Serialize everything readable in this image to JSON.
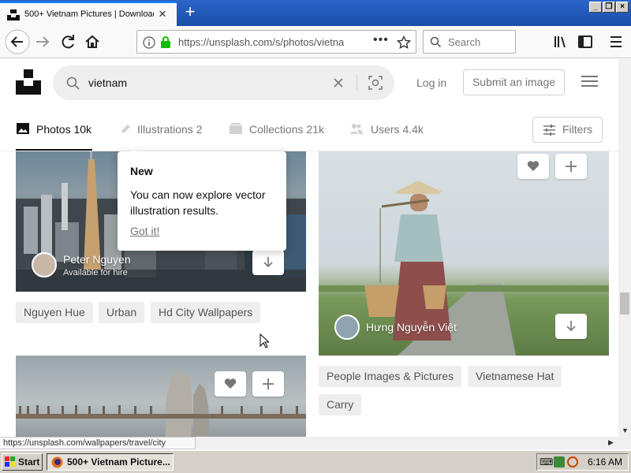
{
  "browser": {
    "tab_title": "500+ Vietnam Pictures | Download",
    "url": "https://unsplash.com/s/photos/vietna",
    "search_placeholder": "Search",
    "status_url": "https://unsplash.com/wallpapers/travel/city"
  },
  "header": {
    "search_query": "vietnam",
    "login_label": "Log in",
    "submit_label": "Submit an image",
    "filters_label": "Filters",
    "tabs": [
      {
        "label": "Photos 10k",
        "active": true
      },
      {
        "label": "Illustrations 2",
        "active": false
      },
      {
        "label": "Collections 21k",
        "active": false
      },
      {
        "label": "Users 4.4k",
        "active": false
      }
    ]
  },
  "tooltip": {
    "title": "New",
    "body": "You can now explore vector illustration results.",
    "action": "Got it!"
  },
  "photos": {
    "left_top": {
      "author": "Peter Nguyen",
      "availability": "Available for hire",
      "tags": [
        "Nguyen Hue",
        "Urban",
        "Hd City Wallpapers"
      ]
    },
    "right": {
      "author": "Hưng Nguyễn Việt",
      "tags": [
        "People Images & Pictures",
        "Vietnamese Hat",
        "Carry"
      ]
    }
  },
  "taskbar": {
    "start_label": "Start",
    "window_label": "500+ Vietnam Picture...",
    "clock": "6:16 AM"
  }
}
